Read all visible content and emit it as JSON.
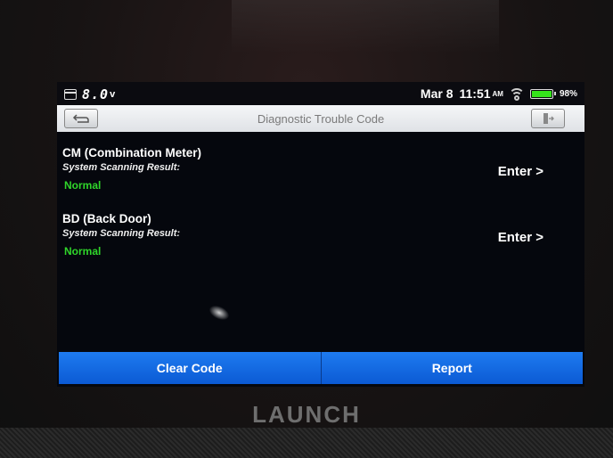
{
  "status_bar": {
    "voltage": "8.0",
    "voltage_unit": "v",
    "date": "Mar 8",
    "time": "11:51",
    "ampm": "AM",
    "battery_percent": "98%",
    "battery_level": 0.98
  },
  "header": {
    "title": "Diagnostic Trouble Code",
    "back_icon": "back-arrow-icon",
    "exit_icon": "exit-door-icon"
  },
  "systems": [
    {
      "name": "CM (Combination Meter)",
      "label": "System Scanning Result:",
      "status": "Normal",
      "enter": "Enter >"
    },
    {
      "name": "BD (Back Door)",
      "label": "System Scanning Result:",
      "status": "Normal",
      "enter": "Enter >"
    }
  ],
  "actions": {
    "clear_code": "Clear Code",
    "report": "Report"
  },
  "device": {
    "brand": "LAUNCH"
  },
  "colors": {
    "status_normal": "#2fd52a",
    "button_blue": "#1467e0",
    "battery_green": "#35e21b"
  }
}
